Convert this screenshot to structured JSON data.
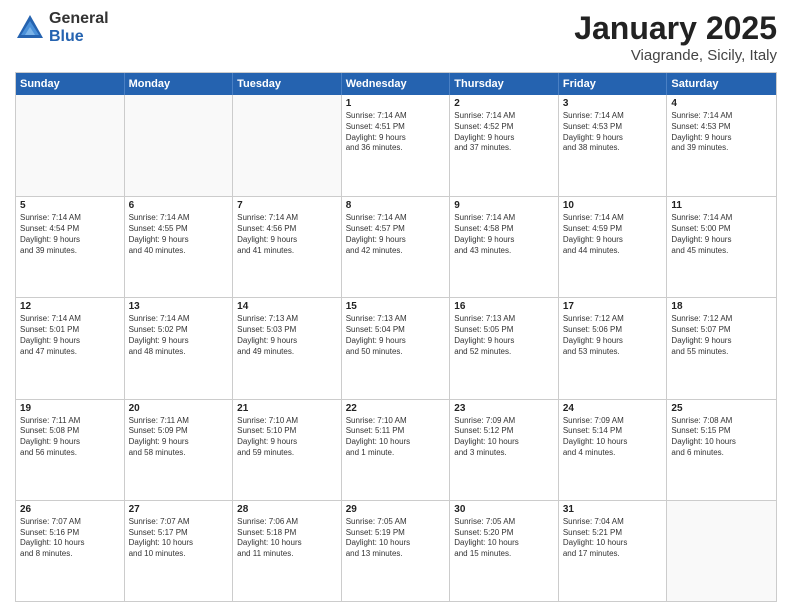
{
  "header": {
    "logo_general": "General",
    "logo_blue": "Blue",
    "title": "January 2025",
    "subtitle": "Viagrande, Sicily, Italy"
  },
  "weekdays": [
    "Sunday",
    "Monday",
    "Tuesday",
    "Wednesday",
    "Thursday",
    "Friday",
    "Saturday"
  ],
  "rows": [
    [
      {
        "day": "",
        "empty": true
      },
      {
        "day": "",
        "empty": true
      },
      {
        "day": "",
        "empty": true
      },
      {
        "day": "1",
        "lines": [
          "Sunrise: 7:14 AM",
          "Sunset: 4:51 PM",
          "Daylight: 9 hours",
          "and 36 minutes."
        ]
      },
      {
        "day": "2",
        "lines": [
          "Sunrise: 7:14 AM",
          "Sunset: 4:52 PM",
          "Daylight: 9 hours",
          "and 37 minutes."
        ]
      },
      {
        "day": "3",
        "lines": [
          "Sunrise: 7:14 AM",
          "Sunset: 4:53 PM",
          "Daylight: 9 hours",
          "and 38 minutes."
        ]
      },
      {
        "day": "4",
        "lines": [
          "Sunrise: 7:14 AM",
          "Sunset: 4:53 PM",
          "Daylight: 9 hours",
          "and 39 minutes."
        ]
      }
    ],
    [
      {
        "day": "5",
        "lines": [
          "Sunrise: 7:14 AM",
          "Sunset: 4:54 PM",
          "Daylight: 9 hours",
          "and 39 minutes."
        ]
      },
      {
        "day": "6",
        "lines": [
          "Sunrise: 7:14 AM",
          "Sunset: 4:55 PM",
          "Daylight: 9 hours",
          "and 40 minutes."
        ]
      },
      {
        "day": "7",
        "lines": [
          "Sunrise: 7:14 AM",
          "Sunset: 4:56 PM",
          "Daylight: 9 hours",
          "and 41 minutes."
        ]
      },
      {
        "day": "8",
        "lines": [
          "Sunrise: 7:14 AM",
          "Sunset: 4:57 PM",
          "Daylight: 9 hours",
          "and 42 minutes."
        ]
      },
      {
        "day": "9",
        "lines": [
          "Sunrise: 7:14 AM",
          "Sunset: 4:58 PM",
          "Daylight: 9 hours",
          "and 43 minutes."
        ]
      },
      {
        "day": "10",
        "lines": [
          "Sunrise: 7:14 AM",
          "Sunset: 4:59 PM",
          "Daylight: 9 hours",
          "and 44 minutes."
        ]
      },
      {
        "day": "11",
        "lines": [
          "Sunrise: 7:14 AM",
          "Sunset: 5:00 PM",
          "Daylight: 9 hours",
          "and 45 minutes."
        ]
      }
    ],
    [
      {
        "day": "12",
        "lines": [
          "Sunrise: 7:14 AM",
          "Sunset: 5:01 PM",
          "Daylight: 9 hours",
          "and 47 minutes."
        ]
      },
      {
        "day": "13",
        "lines": [
          "Sunrise: 7:14 AM",
          "Sunset: 5:02 PM",
          "Daylight: 9 hours",
          "and 48 minutes."
        ]
      },
      {
        "day": "14",
        "lines": [
          "Sunrise: 7:13 AM",
          "Sunset: 5:03 PM",
          "Daylight: 9 hours",
          "and 49 minutes."
        ]
      },
      {
        "day": "15",
        "lines": [
          "Sunrise: 7:13 AM",
          "Sunset: 5:04 PM",
          "Daylight: 9 hours",
          "and 50 minutes."
        ]
      },
      {
        "day": "16",
        "lines": [
          "Sunrise: 7:13 AM",
          "Sunset: 5:05 PM",
          "Daylight: 9 hours",
          "and 52 minutes."
        ]
      },
      {
        "day": "17",
        "lines": [
          "Sunrise: 7:12 AM",
          "Sunset: 5:06 PM",
          "Daylight: 9 hours",
          "and 53 minutes."
        ]
      },
      {
        "day": "18",
        "lines": [
          "Sunrise: 7:12 AM",
          "Sunset: 5:07 PM",
          "Daylight: 9 hours",
          "and 55 minutes."
        ]
      }
    ],
    [
      {
        "day": "19",
        "lines": [
          "Sunrise: 7:11 AM",
          "Sunset: 5:08 PM",
          "Daylight: 9 hours",
          "and 56 minutes."
        ]
      },
      {
        "day": "20",
        "lines": [
          "Sunrise: 7:11 AM",
          "Sunset: 5:09 PM",
          "Daylight: 9 hours",
          "and 58 minutes."
        ]
      },
      {
        "day": "21",
        "lines": [
          "Sunrise: 7:10 AM",
          "Sunset: 5:10 PM",
          "Daylight: 9 hours",
          "and 59 minutes."
        ]
      },
      {
        "day": "22",
        "lines": [
          "Sunrise: 7:10 AM",
          "Sunset: 5:11 PM",
          "Daylight: 10 hours",
          "and 1 minute."
        ]
      },
      {
        "day": "23",
        "lines": [
          "Sunrise: 7:09 AM",
          "Sunset: 5:12 PM",
          "Daylight: 10 hours",
          "and 3 minutes."
        ]
      },
      {
        "day": "24",
        "lines": [
          "Sunrise: 7:09 AM",
          "Sunset: 5:14 PM",
          "Daylight: 10 hours",
          "and 4 minutes."
        ]
      },
      {
        "day": "25",
        "lines": [
          "Sunrise: 7:08 AM",
          "Sunset: 5:15 PM",
          "Daylight: 10 hours",
          "and 6 minutes."
        ]
      }
    ],
    [
      {
        "day": "26",
        "lines": [
          "Sunrise: 7:07 AM",
          "Sunset: 5:16 PM",
          "Daylight: 10 hours",
          "and 8 minutes."
        ]
      },
      {
        "day": "27",
        "lines": [
          "Sunrise: 7:07 AM",
          "Sunset: 5:17 PM",
          "Daylight: 10 hours",
          "and 10 minutes."
        ]
      },
      {
        "day": "28",
        "lines": [
          "Sunrise: 7:06 AM",
          "Sunset: 5:18 PM",
          "Daylight: 10 hours",
          "and 11 minutes."
        ]
      },
      {
        "day": "29",
        "lines": [
          "Sunrise: 7:05 AM",
          "Sunset: 5:19 PM",
          "Daylight: 10 hours",
          "and 13 minutes."
        ]
      },
      {
        "day": "30",
        "lines": [
          "Sunrise: 7:05 AM",
          "Sunset: 5:20 PM",
          "Daylight: 10 hours",
          "and 15 minutes."
        ]
      },
      {
        "day": "31",
        "lines": [
          "Sunrise: 7:04 AM",
          "Sunset: 5:21 PM",
          "Daylight: 10 hours",
          "and 17 minutes."
        ]
      },
      {
        "day": "",
        "empty": true
      }
    ]
  ]
}
